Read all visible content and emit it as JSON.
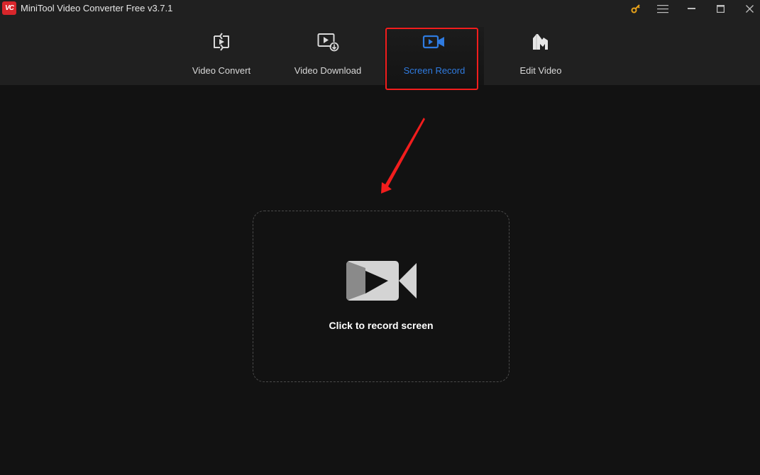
{
  "window": {
    "app_title": "MiniTool Video Converter Free v3.7.1",
    "logo_text": "VC",
    "controls": [
      {
        "name": "key-icon",
        "label": "Register"
      },
      {
        "name": "menu-icon",
        "label": "Menu"
      },
      {
        "name": "minimize-icon",
        "label": "Minimize"
      },
      {
        "name": "maximize-icon",
        "label": "Maximize"
      },
      {
        "name": "close-icon",
        "label": "Close"
      }
    ]
  },
  "tabs": [
    {
      "label": "Video Convert",
      "icon": "video-convert-icon",
      "active": false
    },
    {
      "label": "Video Download",
      "icon": "video-download-icon",
      "active": false
    },
    {
      "label": "Screen Record",
      "icon": "screen-record-icon",
      "active": true
    },
    {
      "label": "Edit Video",
      "icon": "edit-video-icon",
      "active": false
    }
  ],
  "main": {
    "record_label": "Click to record screen",
    "record_icon": "video-camera-icon"
  },
  "colors": {
    "accent": "#2f7be0",
    "annotation": "#f21d1d",
    "key_icon": "#e8a21a",
    "logo": "#d8262b"
  }
}
